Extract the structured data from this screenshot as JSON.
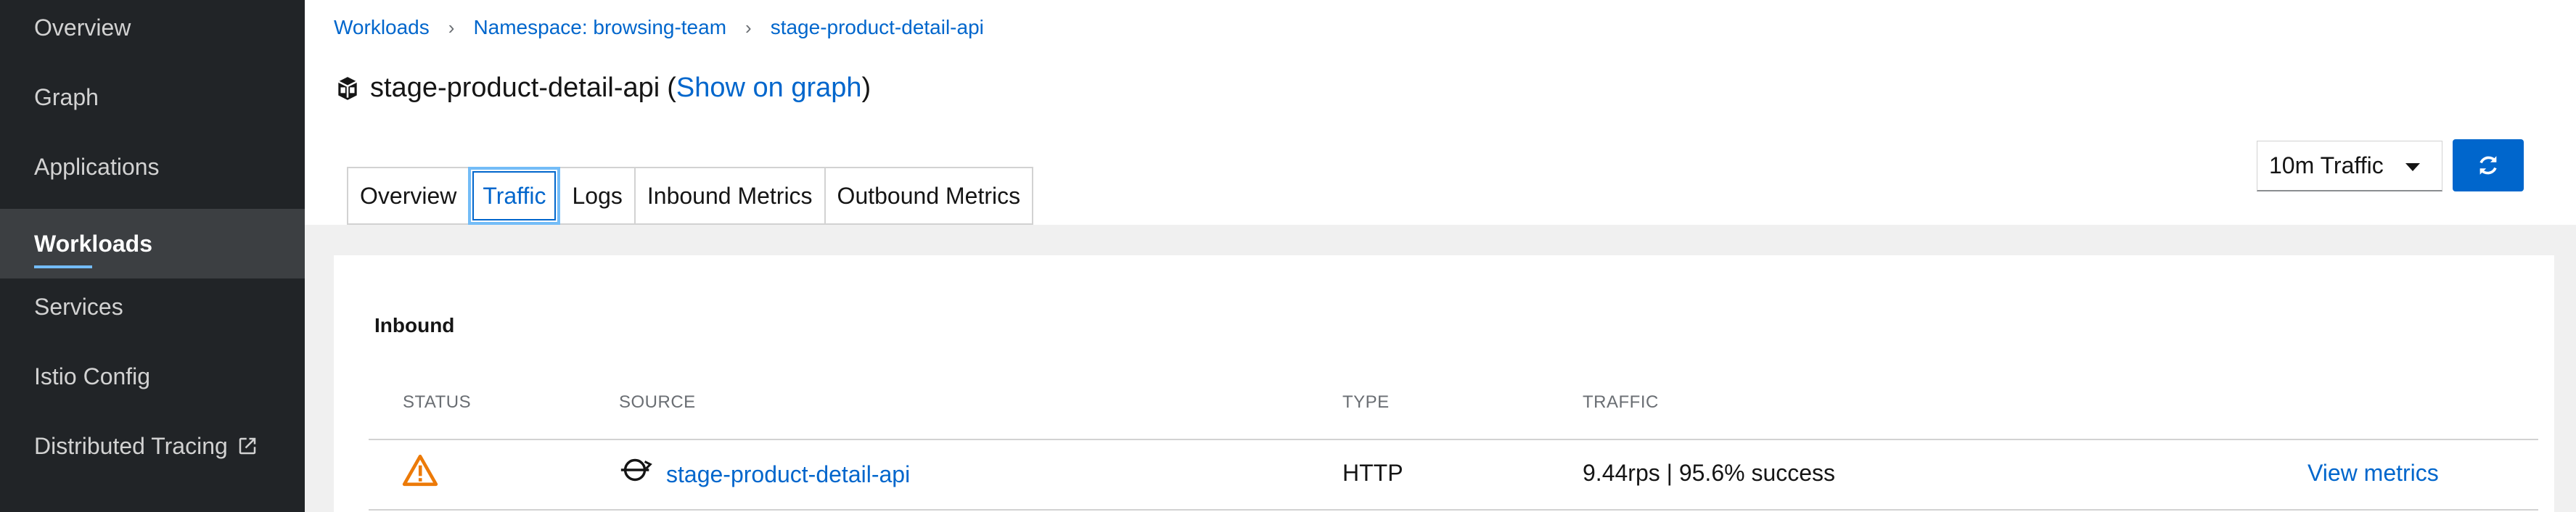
{
  "sidebar": {
    "items": [
      {
        "label": "Overview"
      },
      {
        "label": "Graph"
      },
      {
        "label": "Applications"
      },
      {
        "label": "Workloads",
        "active": true
      },
      {
        "label": "Services"
      },
      {
        "label": "Istio Config"
      },
      {
        "label": "Distributed Tracing",
        "icon": "external-link-icon"
      }
    ]
  },
  "breadcrumb": {
    "items": [
      "Workloads",
      "Namespace: browsing-team",
      "stage-product-detail-api"
    ]
  },
  "header": {
    "title": "stage-product-detail-api",
    "open_paren": "(",
    "graph_link": "Show on graph",
    "close_paren": ")",
    "icon": "workload-icon"
  },
  "tabs": [
    {
      "label": "Overview"
    },
    {
      "label": "Traffic",
      "active": true
    },
    {
      "label": "Logs"
    },
    {
      "label": "Inbound Metrics"
    },
    {
      "label": "Outbound Metrics"
    }
  ],
  "toolbar": {
    "traffic_select": "10m Traffic",
    "refresh_icon": "refresh-icon"
  },
  "inbound": {
    "title": "Inbound",
    "columns": [
      "STATUS",
      "SOURCE",
      "TYPE",
      "TRAFFIC"
    ],
    "rows": [
      {
        "status_icon": "warning-icon",
        "source_icon": "workload-source-icon",
        "source": "stage-product-detail-api",
        "type": "HTTP",
        "traffic": "9.44rps | 95.6% success",
        "action": "View metrics"
      }
    ]
  },
  "colors": {
    "sidebar_bg": "#212427",
    "sidebar_active_bg": "#3c3f42",
    "accent": "#0066cc",
    "active_underline": "#73bcf7",
    "warning": "#ec7a08"
  }
}
